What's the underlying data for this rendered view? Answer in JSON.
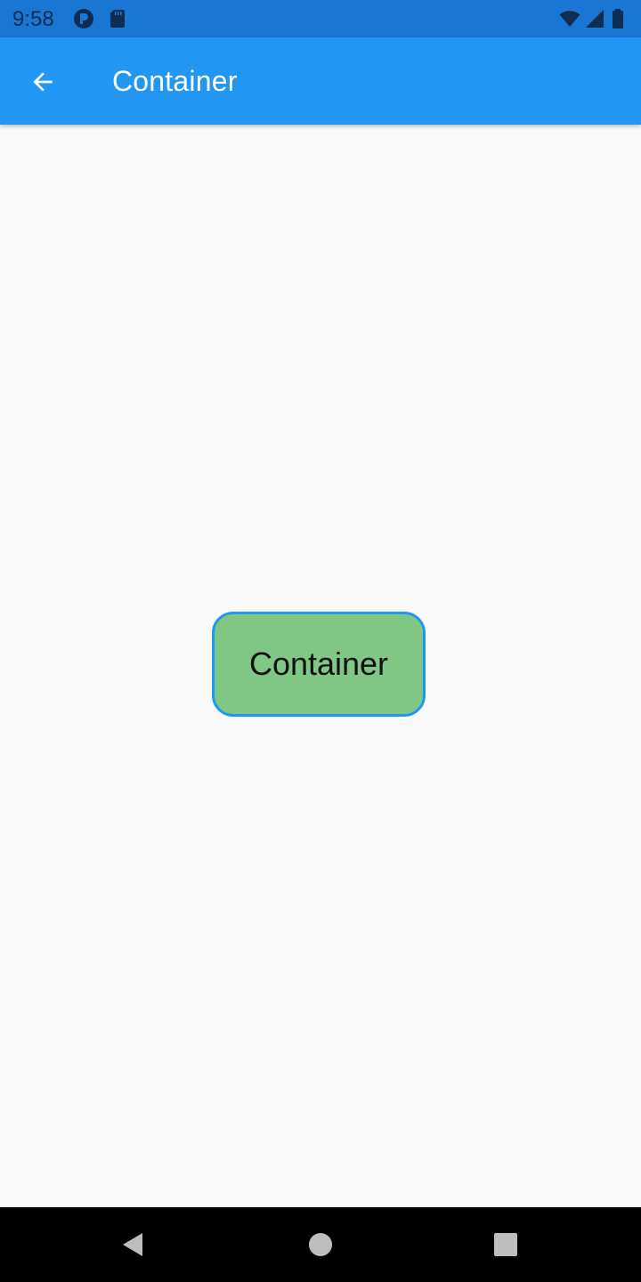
{
  "status_bar": {
    "time": "9:58",
    "icons": [
      "circle-p-icon",
      "sd-card-icon",
      "wifi-icon",
      "signal-icon",
      "battery-icon"
    ],
    "background_color": "#1976d2"
  },
  "app_bar": {
    "title": "Container",
    "back_icon": "arrow-back-icon",
    "background_color": "#2196f3"
  },
  "main": {
    "container": {
      "label": "Container",
      "fill_color": "#81c784",
      "border_color": "#2196f3"
    }
  },
  "nav_bar": {
    "buttons": [
      "back-triangle-icon",
      "home-circle-icon",
      "recents-square-icon"
    ]
  }
}
